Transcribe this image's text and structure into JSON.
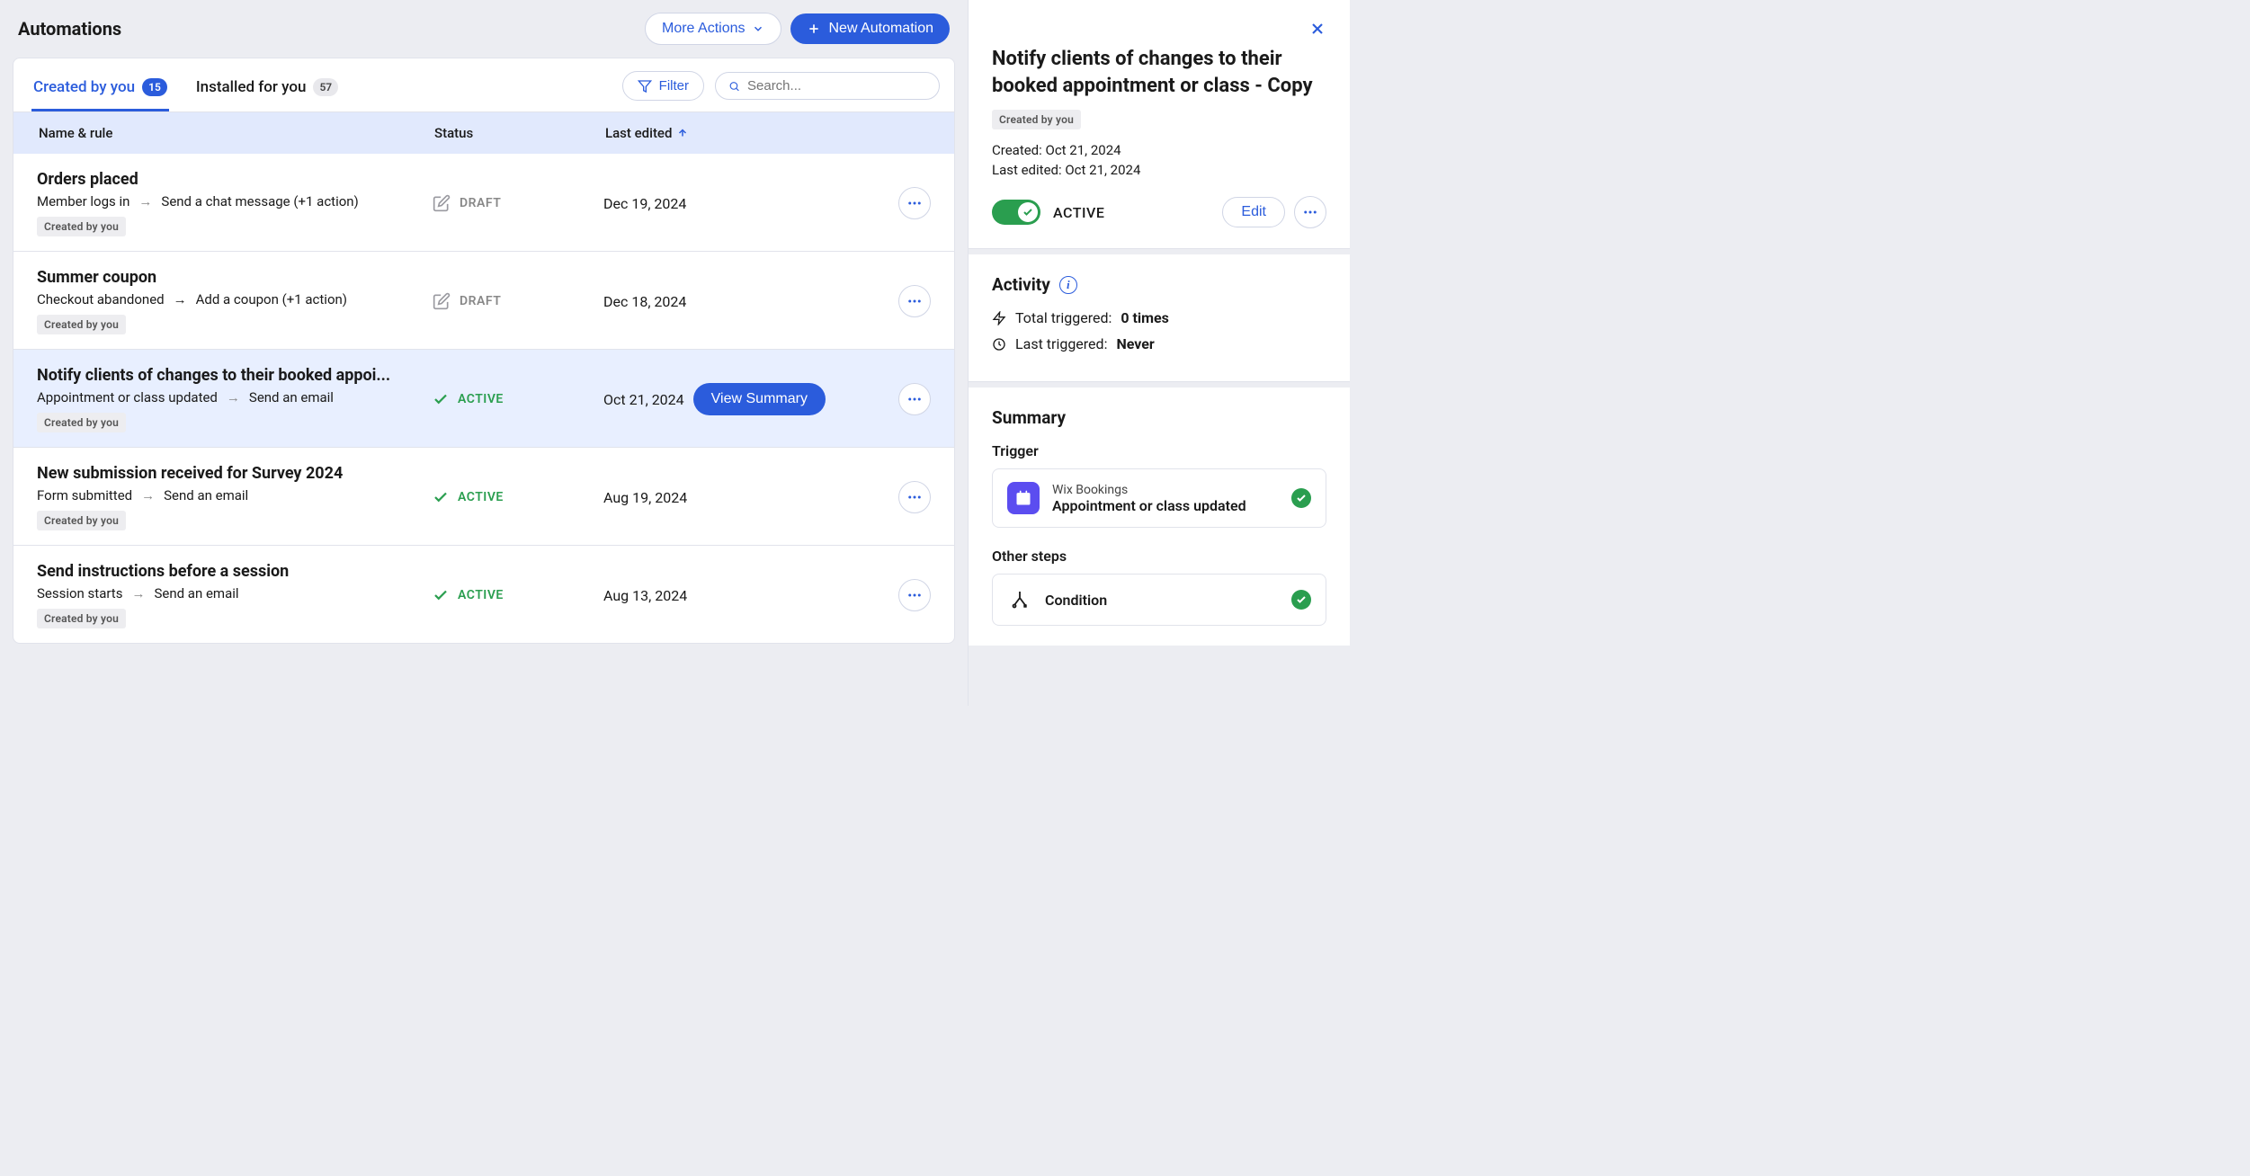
{
  "header": {
    "title": "Automations",
    "more_actions": "More Actions",
    "new_automation": "New Automation"
  },
  "tabs": {
    "created": {
      "label": "Created by you",
      "count": "15"
    },
    "installed": {
      "label": "Installed for you",
      "count": "57"
    }
  },
  "controls": {
    "filter_label": "Filter",
    "search_placeholder": "Search..."
  },
  "table": {
    "col_name": "Name & rule",
    "col_status": "Status",
    "col_edited": "Last edited"
  },
  "statuses": {
    "draft": "DRAFT",
    "active": "ACTIVE"
  },
  "common": {
    "created_by_you": "Created by you",
    "view_summary": "View Summary"
  },
  "rows": [
    {
      "title": "Orders placed",
      "trigger": "Member logs in",
      "action": "Send a chat message (+1 action)",
      "status": "DRAFT",
      "date": "Dec 19, 2024"
    },
    {
      "title": "Summer coupon",
      "trigger": "Checkout abandoned",
      "action": "Add a coupon (+1 action)",
      "status": "DRAFT",
      "date": "Dec 18, 2024"
    },
    {
      "title": "Notify clients of changes to their booked appoi...",
      "trigger": "Appointment or class updated",
      "action": "Send an email",
      "status": "ACTIVE",
      "date": "Oct 21, 2024"
    },
    {
      "title": "New submission received for Survey 2024",
      "trigger": "Form submitted",
      "action": "Send an email",
      "status": "ACTIVE",
      "date": "Aug 19, 2024"
    },
    {
      "title": "Send instructions before a session",
      "trigger": "Session starts",
      "action": "Send an email",
      "status": "ACTIVE",
      "date": "Aug 13, 2024"
    }
  ],
  "side": {
    "title": "Notify clients of changes to their booked appointment or class - Copy",
    "tag": "Created by you",
    "created_label": "Created: ",
    "created_value": "Oct 21, 2024",
    "edited_label": "Last edited: ",
    "edited_value": "Oct 21, 2024",
    "status": "ACTIVE",
    "edit": "Edit",
    "activity": {
      "title": "Activity",
      "total_label": "Total triggered: ",
      "total_value": "0 times",
      "last_label": "Last triggered: ",
      "last_value": "Never"
    },
    "summary": {
      "title": "Summary",
      "trigger_label": "Trigger",
      "trigger_app": "Wix Bookings",
      "trigger_desc": "Appointment or class updated",
      "other_steps_label": "Other steps",
      "condition_label": "Condition"
    }
  }
}
